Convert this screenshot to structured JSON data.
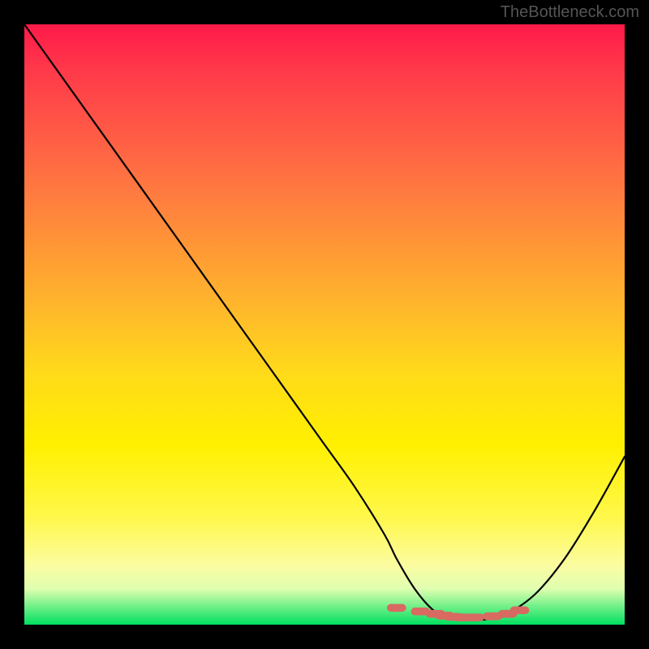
{
  "attribution": "TheBottleneck.com",
  "chart_data": {
    "type": "line",
    "title": "",
    "xlabel": "",
    "ylabel": "",
    "xlim": [
      0,
      100
    ],
    "ylim": [
      0,
      100
    ],
    "series": [
      {
        "name": "bottleneck-curve",
        "x": [
          0,
          5,
          10,
          15,
          20,
          25,
          30,
          35,
          40,
          45,
          50,
          55,
          60,
          62,
          65,
          68,
          70,
          72,
          74,
          76,
          78,
          80,
          85,
          90,
          95,
          100
        ],
        "values": [
          100,
          93,
          86,
          79,
          72,
          65,
          58,
          51,
          44,
          37,
          30,
          23,
          15,
          11,
          6,
          2.5,
          1.5,
          1,
          0.8,
          0.8,
          1,
          1.5,
          5,
          11,
          19,
          28
        ]
      }
    ],
    "markers": {
      "name": "optimal-range-dots",
      "x": [
        62,
        66,
        68.5,
        70,
        71.5,
        73,
        75,
        78,
        80.5,
        82.5
      ],
      "values": [
        2.8,
        2.2,
        1.8,
        1.5,
        1.3,
        1.2,
        1.2,
        1.4,
        1.8,
        2.4
      ],
      "color": "#d86a62",
      "size": 6
    },
    "gradient_stops": [
      {
        "pos": 0,
        "color": "#ff1a4a"
      },
      {
        "pos": 50,
        "color": "#ffda1a"
      },
      {
        "pos": 90,
        "color": "#fcfca0"
      },
      {
        "pos": 100,
        "color": "#00e060"
      }
    ]
  }
}
